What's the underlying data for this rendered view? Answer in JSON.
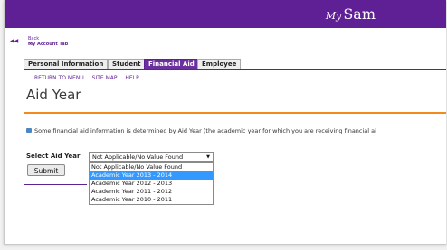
{
  "header": {
    "brand_prefix": "My",
    "brand_name": "Sam"
  },
  "back_link": {
    "line1": "Back to",
    "line2": "My Account Tab"
  },
  "tabs": [
    {
      "label": "Personal Information"
    },
    {
      "label": "Student"
    },
    {
      "label": "Financial Aid"
    },
    {
      "label": "Employee"
    }
  ],
  "nav_links": [
    "RETURN TO MENU",
    "SITE MAP",
    "HELP"
  ],
  "page_title": "Aid Year",
  "info_text": "Some financial aid information is determined by Aid Year (the academic year for which you are receiving financial ai",
  "form": {
    "select_label": "Select Aid Year",
    "selected_value": "Not Applicable/No Value Found",
    "options": [
      "Not Applicable/No Value Found",
      "Academic Year 2013 - 2014",
      "Academic Year 2012 - 2013",
      "Academic Year 2011 - 2012",
      "Academic Year 2010 - 2011"
    ],
    "highlighted_option": "Academic Year 2013 - 2014",
    "submit_label": "Submit"
  },
  "colors": {
    "brand_purple": "#5f1f95",
    "accent_orange": "#f28a1e",
    "highlight_blue": "#3399ff"
  }
}
